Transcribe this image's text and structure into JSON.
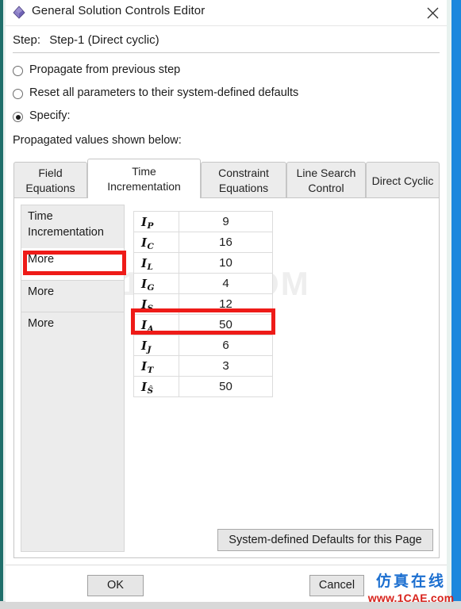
{
  "window": {
    "title": "General Solution Controls Editor",
    "icon": "abaqus-diamond-icon",
    "close_label": "✕"
  },
  "step": {
    "label": "Step:",
    "value": "Step-1 (Direct cyclic)"
  },
  "options": {
    "items": [
      {
        "label": "Propagate from previous step",
        "checked": false
      },
      {
        "label": "Reset all parameters to their system-defined defaults",
        "checked": false
      },
      {
        "label": "Specify:",
        "checked": true
      }
    ],
    "note": "Propagated values shown below:"
  },
  "tabs": [
    {
      "line1": "Field",
      "line2": "Equations",
      "active": false
    },
    {
      "line1": "Time",
      "line2": "Incrementation",
      "active": true
    },
    {
      "line1": "Constraint",
      "line2": "Equations",
      "active": false
    },
    {
      "line1": "Line Search",
      "line2": "Control",
      "active": false
    },
    {
      "line1": "Direct Cyclic",
      "line2": "",
      "active": false
    }
  ],
  "list": {
    "items": [
      {
        "line1": "Time",
        "line2": "Incrementation",
        "selected": false
      },
      {
        "line1": "More",
        "line2": "",
        "selected": true
      },
      {
        "line1": "More",
        "line2": "",
        "selected": false
      },
      {
        "line1": "More",
        "line2": "",
        "selected": false
      }
    ]
  },
  "table": {
    "rows": [
      {
        "key": "I",
        "sub": "P",
        "value": "9",
        "highlighted": false
      },
      {
        "key": "I",
        "sub": "C",
        "value": "16",
        "highlighted": false
      },
      {
        "key": "I",
        "sub": "L",
        "value": "10",
        "highlighted": false
      },
      {
        "key": "I",
        "sub": "G",
        "value": "4",
        "highlighted": false
      },
      {
        "key": "I",
        "sub": "S",
        "value": "12",
        "highlighted": false
      },
      {
        "key": "I",
        "sub": "A",
        "value": "50",
        "highlighted": true
      },
      {
        "key": "I",
        "sub": "J",
        "value": "6",
        "highlighted": false
      },
      {
        "key": "I",
        "sub": "T",
        "value": "3",
        "highlighted": false
      },
      {
        "key": "I",
        "sub": "Ŝ",
        "value": "50",
        "highlighted": false
      }
    ]
  },
  "panel": {
    "defaults_button": "System-defined Defaults for this Page",
    "watermark": "1CAE.COM"
  },
  "footer": {
    "ok_label": "OK",
    "cancel_label": "Cancel"
  },
  "watermark": {
    "cn": "仿真在线",
    "url": "www.1CAE.com"
  },
  "colors": {
    "annotation_red": "#ee1b18",
    "edge_blue": "#1c87dd",
    "edge_teal": "#1f6f6b",
    "watermark_blue": "#1c6fd0",
    "watermark_red": "#d8231c"
  }
}
